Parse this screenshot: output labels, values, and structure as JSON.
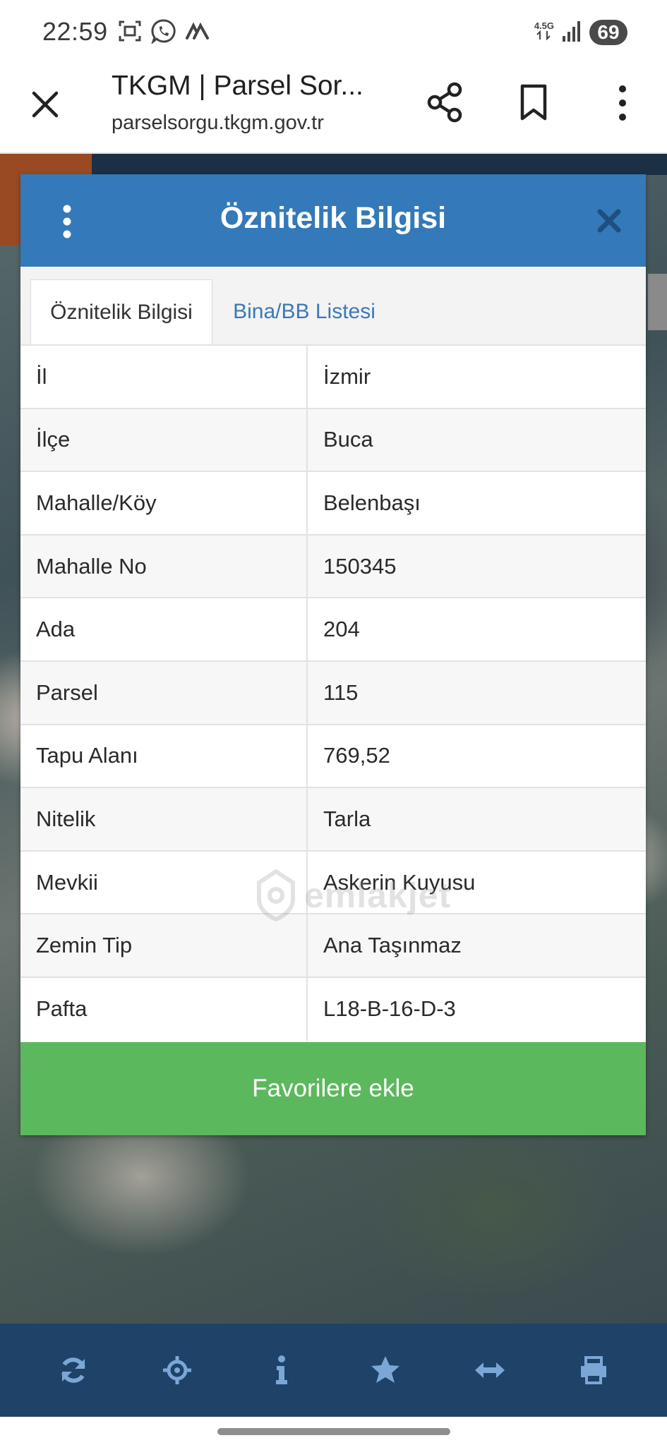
{
  "status_bar": {
    "time": "22:59",
    "network": "4.5G",
    "battery": "69",
    "icons": [
      "screenshot-icon",
      "whatsapp-icon",
      "signal-activity-icon",
      "signal-bars-icon",
      "battery-icon"
    ]
  },
  "browser": {
    "title": "TKGM | Parsel Sor...",
    "url": "parselsorgu.tkgm.gov.tr",
    "icons": [
      "close-icon",
      "share-icon",
      "bookmark-icon",
      "more-vert-icon"
    ]
  },
  "modal": {
    "title": "Öznitelik Bilgisi",
    "tabs": [
      {
        "label": "Öznitelik Bilgisi",
        "active": true
      },
      {
        "label": "Bina/BB Listesi",
        "active": false
      }
    ],
    "rows": [
      {
        "key": "İl",
        "value": "İzmir"
      },
      {
        "key": "İlçe",
        "value": "Buca"
      },
      {
        "key": "Mahalle/Köy",
        "value": "Belenbaşı"
      },
      {
        "key": "Mahalle No",
        "value": "150345"
      },
      {
        "key": "Ada",
        "value": "204"
      },
      {
        "key": "Parsel",
        "value": "115"
      },
      {
        "key": "Tapu Alanı",
        "value": "769,52"
      },
      {
        "key": "Nitelik",
        "value": "Tarla"
      },
      {
        "key": "Mevkii",
        "value": "Askerin Kuyusu"
      },
      {
        "key": "Zemin Tip",
        "value": "Ana Taşınmaz"
      },
      {
        "key": "Pafta",
        "value": "L18-B-16-D-3"
      }
    ],
    "favorite_button": "Favorilere ekle",
    "watermark": "emlakjet"
  },
  "toolbar": {
    "icons": [
      "refresh-icon",
      "locate-icon",
      "info-icon",
      "star-icon",
      "measure-icon",
      "print-icon"
    ]
  },
  "colors": {
    "header_blue": "#3479b9",
    "tab_link_blue": "#3a7ab8",
    "button_green": "#5cb85c",
    "toolbar_navy": "#1e4268"
  }
}
